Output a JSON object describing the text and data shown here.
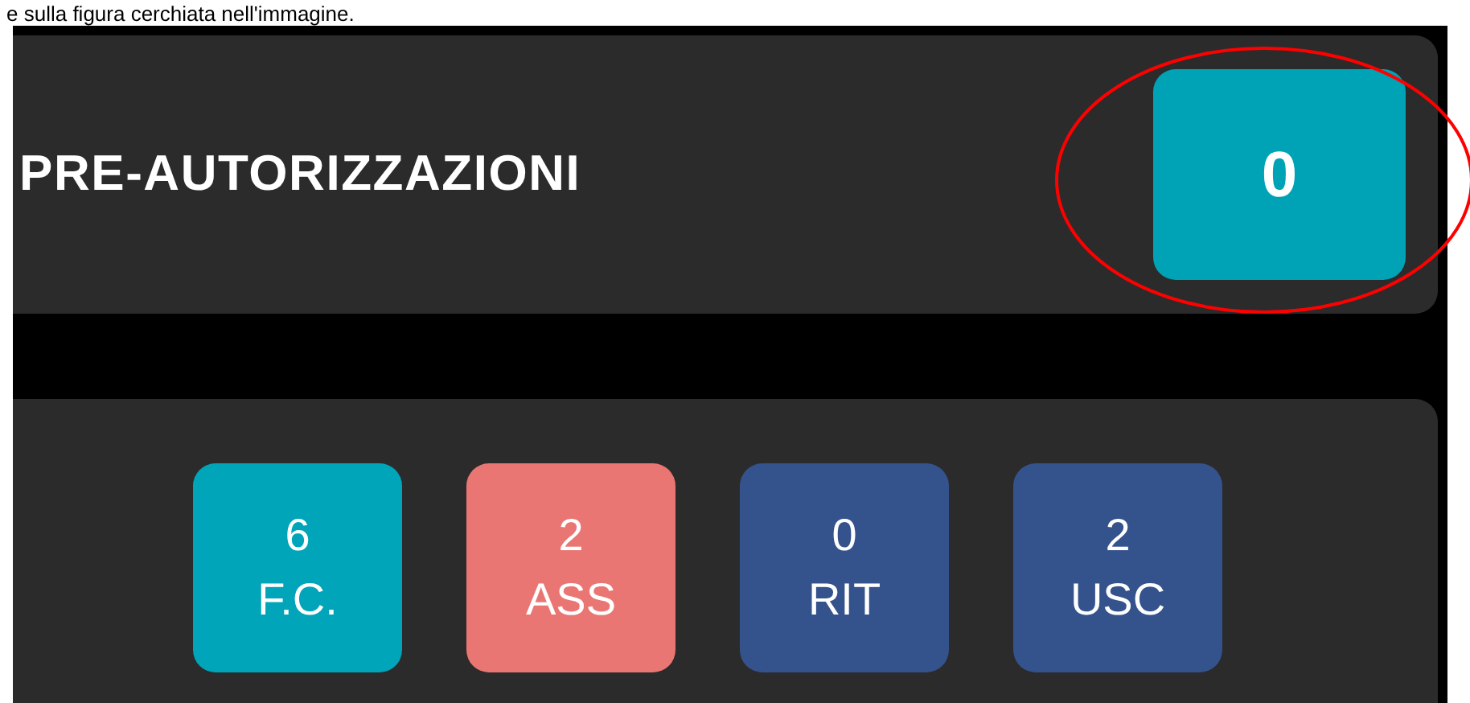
{
  "caption": "e sulla figura cerchiata nell'immagine.",
  "pre_authorizations": {
    "title": "PRE-AUTORIZZAZIONI",
    "count": "0"
  },
  "counters": [
    {
      "value": "6",
      "label": "F.C.",
      "color": "#00a5b9"
    },
    {
      "value": "2",
      "label": "ASS",
      "color": "#ea7674"
    },
    {
      "value": "0",
      "label": "RIT",
      "color": "#34528c"
    },
    {
      "value": "2",
      "label": "USC",
      "color": "#34528c"
    }
  ]
}
